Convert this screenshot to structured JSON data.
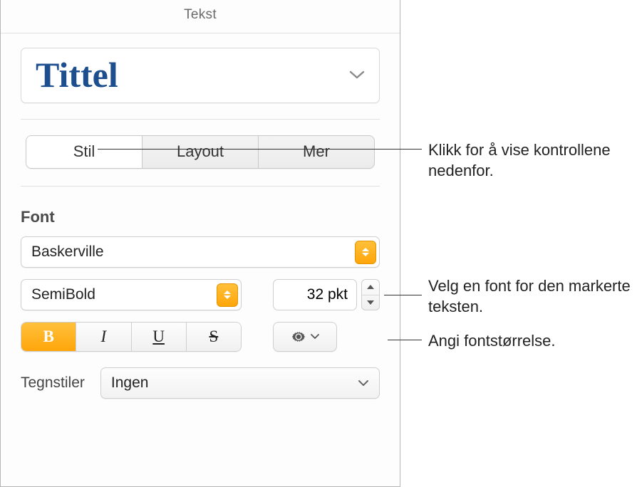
{
  "header": {
    "title": "Tekst"
  },
  "styleSelector": {
    "name": "Tittel"
  },
  "tabs": {
    "stil": "Stil",
    "layout": "Layout",
    "mer": "Mer"
  },
  "font": {
    "sectionLabel": "Font",
    "family": "Baskerville",
    "typeface": "SemiBold",
    "size": "32 pkt",
    "boldGlyph": "B",
    "italicGlyph": "I",
    "underlineGlyph": "U",
    "strikeGlyph": "S"
  },
  "charStyles": {
    "label": "Tegnstiler",
    "value": "Ingen"
  },
  "annotations": {
    "tabs": "Klikk for å vise kontrollene nedenfor.",
    "font": "Velg en font for den markerte teksten.",
    "size": "Angi fontstørrelse."
  }
}
